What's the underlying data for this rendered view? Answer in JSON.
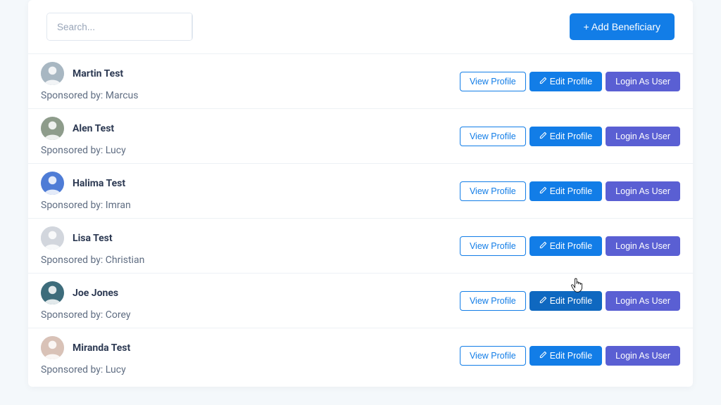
{
  "toolbar": {
    "search_placeholder": "Search...",
    "add_label": "+ Add Beneficiary"
  },
  "labels": {
    "view": "View Profile",
    "edit": "Edit Profile",
    "login": "Login As User",
    "sponsored_prefix": "Sponsored by: "
  },
  "rows": [
    {
      "name": "Martin Test",
      "sponsor": "Marcus",
      "avatar_bg": "#a8b7c2"
    },
    {
      "name": "Alen Test",
      "sponsor": "Lucy",
      "avatar_bg": "#8e9c8b"
    },
    {
      "name": "Halima Test",
      "sponsor": "Imran",
      "avatar_bg": "#4e7cd6"
    },
    {
      "name": "Lisa Test",
      "sponsor": "Christian",
      "avatar_bg": "#d2d6dd"
    },
    {
      "name": "Joe Jones",
      "sponsor": "Corey",
      "avatar_bg": "#3d6c7b",
      "edit_active": true
    },
    {
      "name": "Miranda Test",
      "sponsor": "Lucy",
      "avatar_bg": "#d9c2b7"
    }
  ]
}
